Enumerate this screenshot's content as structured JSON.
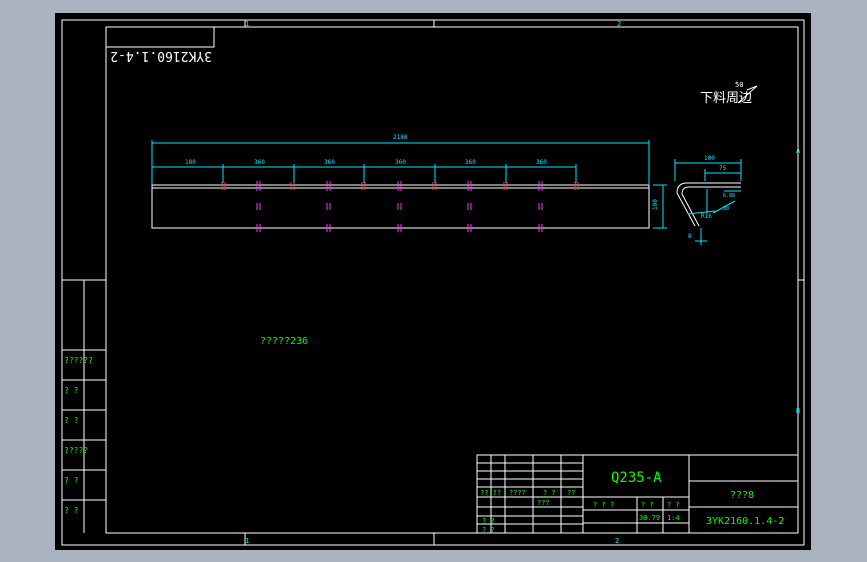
{
  "drawing": {
    "stamp_mirrored": "3YK2160.1.4-2",
    "process_note": "下料周边",
    "roughness": "50",
    "text_note": "?????236",
    "zone_top": [
      "1",
      "2"
    ],
    "zone_bottom": [
      "1",
      "2"
    ],
    "zone_right": [
      "A",
      "B"
    ],
    "dims": {
      "overall_length": "2180",
      "pitch_first": "180",
      "pitches": [
        "360",
        "360",
        "360",
        "360",
        "360"
      ],
      "height": "100",
      "section_width": "100",
      "section_flange": "75",
      "section_small": "6.88",
      "section_thk": "8",
      "section_bend": "R16",
      "section_angle": "20"
    }
  },
  "left_strip": {
    "cells": [
      "??????",
      "?   ?",
      "?   ?",
      "?????",
      "?   ?",
      "?   ?"
    ]
  },
  "title_block": {
    "material": "Q235-A",
    "scale_label": "???8",
    "drawing_no": "3YK2160.1.4-2",
    "mass_label": "? ? ?",
    "weight": "30.79",
    "ratio": "1:4",
    "qty_labels": [
      "? ?",
      "? ?"
    ],
    "sign_row": [
      "?? ??",
      "????",
      "? ?",
      "??"
    ],
    "lower_left": [
      "? ?",
      "???",
      "? ?"
    ]
  }
}
